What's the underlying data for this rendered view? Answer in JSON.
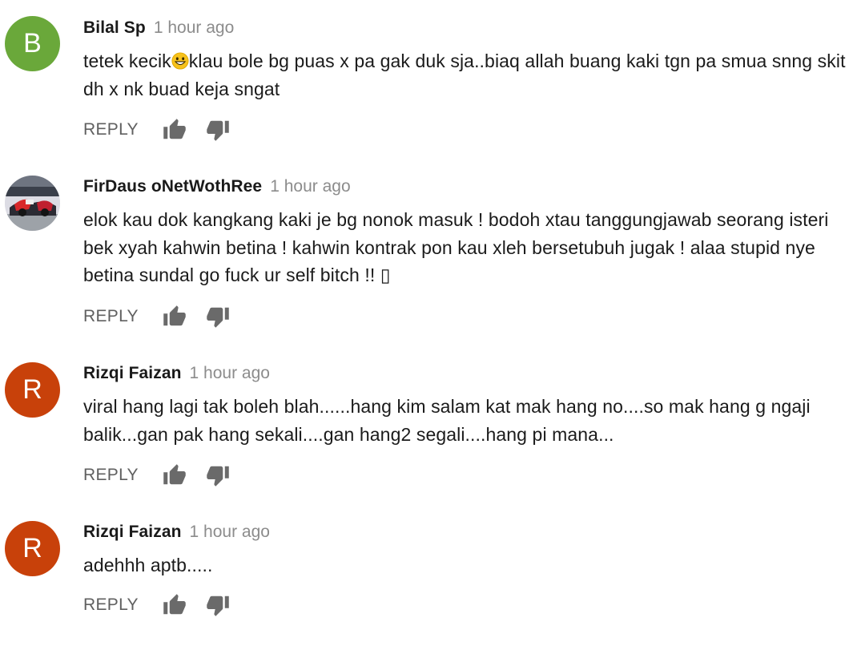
{
  "colors": {
    "avatar_b": "#6aa83a",
    "avatar_r": "#c8410a",
    "author": "#1a1a1a",
    "timestamp": "#8c8c8c",
    "action": "#606060"
  },
  "icons": [
    "thumb-up-icon",
    "thumb-down-icon",
    "grinning-emoji-icon"
  ],
  "comments": [
    {
      "avatar_letter": "B",
      "author": "Bilal Sp",
      "time": "1 hour ago",
      "text_before_emoji": "tetek kecik",
      "text_after_emoji": "klau bole bg puas x pa gak duk sja..biaq allah buang kaki tgn pa smua snng skit dh x nk buad keja sngat",
      "reply_label": "REPLY"
    },
    {
      "avatar_letter": "",
      "author": "FirDaus oNetWothRee",
      "time": "1 hour ago",
      "text": "elok kau dok kangkang kaki je bg nonok masuk ! bodoh xtau tanggungjawab seorang isteri bek xyah kahwin betina ! kahwin kontrak pon kau xleh bersetubuh jugak ! alaa stupid nye betina sundal go fuck ur self bitch !! ▯",
      "reply_label": "REPLY"
    },
    {
      "avatar_letter": "R",
      "author": "Rizqi Faizan",
      "time": "1 hour ago",
      "text": "viral hang lagi tak boleh blah......hang kim salam kat mak hang no....so mak hang g ngaji balik...gan pak hang sekali....gan hang2 segali....hang pi mana...",
      "reply_label": "REPLY"
    },
    {
      "avatar_letter": "R",
      "author": "Rizqi Faizan",
      "time": "1 hour ago",
      "text": "adehhh aptb.....",
      "reply_label": "REPLY"
    }
  ]
}
